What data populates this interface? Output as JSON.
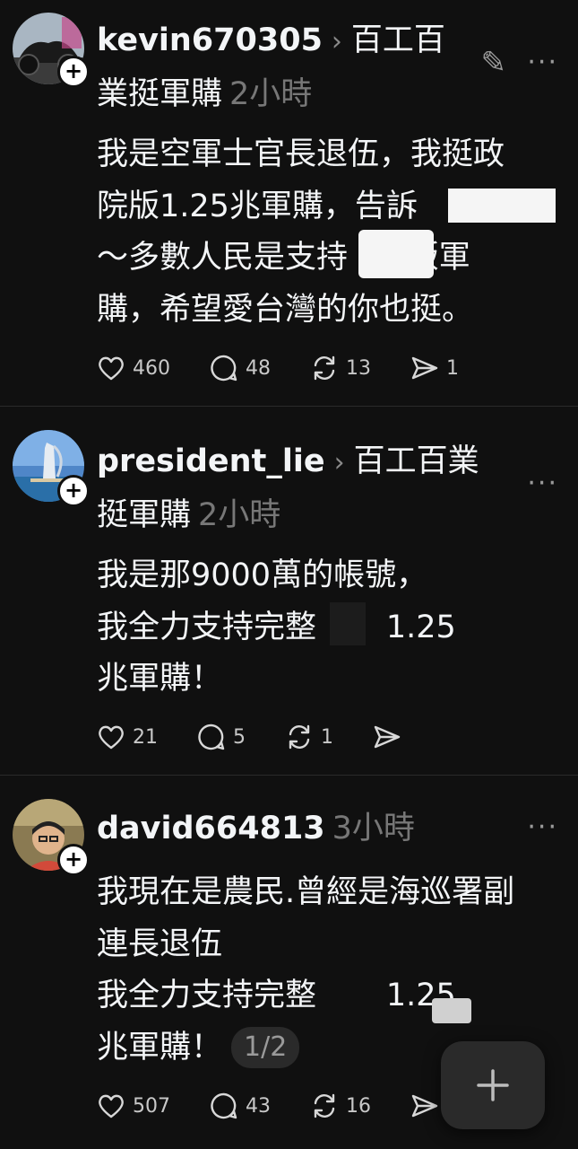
{
  "posts": [
    {
      "username": "kevin670305",
      "topic_line1": "百工百",
      "topic_line2": "業挺軍購",
      "time": "2小時",
      "body": "我是空軍士官長退伍，我挺政\n院版1.25兆軍購，告訴\n～多數人民是支持      版軍\n購，希望愛台灣的你也挺。",
      "likes": "460",
      "replies": "48",
      "reposts": "13",
      "shares": "1"
    },
    {
      "username": "president_lie",
      "topic_line1": "百工百業",
      "topic_line2": "挺軍購",
      "time": "2小時",
      "body": "我是那9000萬的帳號，\n我全力支持完整       1.25\n兆軍購！",
      "likes": "21",
      "replies": "5",
      "reposts": "1",
      "shares": ""
    },
    {
      "username": "david664813",
      "time": "3小時",
      "body": "我現在是農民.曾經是海巡署副\n連長退伍\n我全力支持完整       1.25\n兆軍購！",
      "pager": "1/2",
      "likes": "507",
      "replies": "43",
      "reposts": "16",
      "shares": ""
    }
  ],
  "icons": {
    "follow": "+",
    "chevron": "›",
    "more": "···",
    "edit": "✎",
    "fab": "+"
  },
  "colors": {
    "background": "#101010",
    "text": "#f3f5f7",
    "muted": "#777777",
    "divider": "#2a2a2a"
  }
}
